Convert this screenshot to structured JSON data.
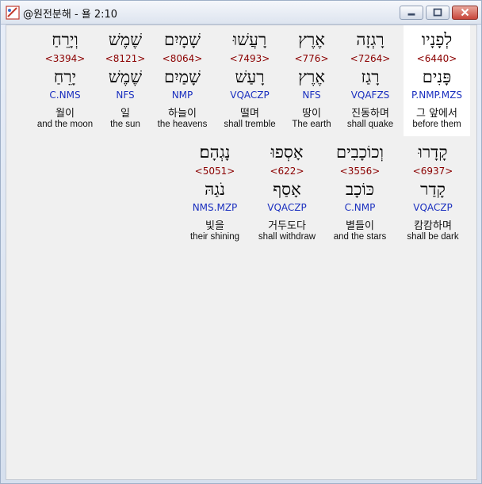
{
  "window": {
    "title": "@원전분해 - 욜 2:10"
  },
  "row1": [
    {
      "hebrew": "לְפָנָיו",
      "strong": "<6440>",
      "lemma": "פָּנִים",
      "morph": "P.NMP.MZS",
      "korean": "그 앞에서",
      "english": "before them"
    },
    {
      "hebrew": "רָגְזָה",
      "strong": "<7264>",
      "lemma": "רָגַז",
      "morph": "VQAFZS",
      "korean": "진동하며",
      "english": "shall quake"
    },
    {
      "hebrew": "אֶרֶץ",
      "strong": "<776>",
      "lemma": "אֶרֶץ",
      "morph": "NFS",
      "korean": "땅이",
      "english": "The earth"
    },
    {
      "hebrew": "רָעֲשׁוּ",
      "strong": "<7493>",
      "lemma": "רָעַשׁ",
      "morph": "VQACZP",
      "korean": "떨며",
      "english": "shall tremble"
    },
    {
      "hebrew": "שָׁמָיִם",
      "strong": "<8064>",
      "lemma": "שָׁמַיִם",
      "morph": "NMP",
      "korean": "하늘이",
      "english": "the heavens"
    },
    {
      "hebrew": "שֶׁמֶשׁ",
      "strong": "<8121>",
      "lemma": "שֶׁמֶשׁ",
      "morph": "NFS",
      "korean": "일",
      "english": "the sun"
    },
    {
      "hebrew": "וְיָרֵחַ",
      "strong": "<3394>",
      "lemma": "יָרֵחַ",
      "morph": "C.NMS",
      "korean": "월이",
      "english": "and the moon"
    }
  ],
  "row2": [
    {
      "hebrew": "קָדָרוּ",
      "strong": "<6937>",
      "lemma": "קָדַר",
      "morph": "VQACZP",
      "korean": "캄캄하며",
      "english": "shall be dark"
    },
    {
      "hebrew": "וְכוֹכָבִים",
      "strong": "<3556>",
      "lemma": "כּוֹכָב",
      "morph": "C.NMP",
      "korean": "별들이",
      "english": "and the stars"
    },
    {
      "hebrew": "אָסְפוּ",
      "strong": "<622>",
      "lemma": "אָסַף",
      "morph": "VQACZP",
      "korean": "거두도다",
      "english": "shall withdraw"
    },
    {
      "hebrew": "נָגְהָם׃",
      "strong": "<5051>",
      "lemma": "נֹגַהּ",
      "morph": "NMS.MZP",
      "korean": "빛을",
      "english": "their shining"
    }
  ]
}
